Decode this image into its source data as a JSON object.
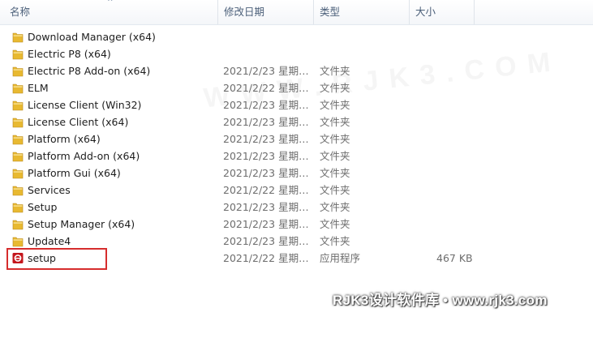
{
  "header": {
    "name_label": "名称",
    "date_label": "修改日期",
    "type_label": "类型",
    "size_label": "大小",
    "sort_glyph": "^"
  },
  "files": [
    {
      "name": "Download Manager (x64)",
      "date": "",
      "type": "",
      "size": "",
      "icon": "folder-icon"
    },
    {
      "name": "Electric P8 (x64)",
      "date": "",
      "type": "",
      "size": "",
      "icon": "folder-icon"
    },
    {
      "name": "Electric P8 Add-on (x64)",
      "date": "2021/2/23 星期…",
      "type": "文件夹",
      "size": "",
      "icon": "folder-icon"
    },
    {
      "name": "ELM",
      "date": "2021/2/22 星期…",
      "type": "文件夹",
      "size": "",
      "icon": "folder-icon"
    },
    {
      "name": "License Client (Win32)",
      "date": "2021/2/23 星期…",
      "type": "文件夹",
      "size": "",
      "icon": "folder-icon"
    },
    {
      "name": "License Client (x64)",
      "date": "2021/2/23 星期…",
      "type": "文件夹",
      "size": "",
      "icon": "folder-icon"
    },
    {
      "name": "Platform (x64)",
      "date": "2021/2/23 星期…",
      "type": "文件夹",
      "size": "",
      "icon": "folder-icon"
    },
    {
      "name": "Platform Add-on (x64)",
      "date": "2021/2/23 星期…",
      "type": "文件夹",
      "size": "",
      "icon": "folder-icon"
    },
    {
      "name": "Platform Gui (x64)",
      "date": "2021/2/23 星期…",
      "type": "文件夹",
      "size": "",
      "icon": "folder-icon"
    },
    {
      "name": "Services",
      "date": "2021/2/22 星期…",
      "type": "文件夹",
      "size": "",
      "icon": "folder-icon"
    },
    {
      "name": "Setup",
      "date": "2021/2/23 星期…",
      "type": "文件夹",
      "size": "",
      "icon": "folder-icon"
    },
    {
      "name": "Setup Manager (x64)",
      "date": "2021/2/23 星期…",
      "type": "文件夹",
      "size": "",
      "icon": "folder-icon"
    },
    {
      "name": "Update4",
      "date": "2021/2/23 星期…",
      "type": "文件夹",
      "size": "",
      "icon": "folder-icon"
    },
    {
      "name": "setup",
      "date": "2021/2/22 星期…",
      "type": "应用程序",
      "size": "467 KB",
      "icon": "setup-app-icon"
    }
  ],
  "watermark": {
    "text": "RJK3设计软件库 • www.rjk3.com"
  },
  "colors": {
    "folder": "#e8b931",
    "highlight_border": "#d62d2d",
    "app_icon": "#c4161c"
  }
}
